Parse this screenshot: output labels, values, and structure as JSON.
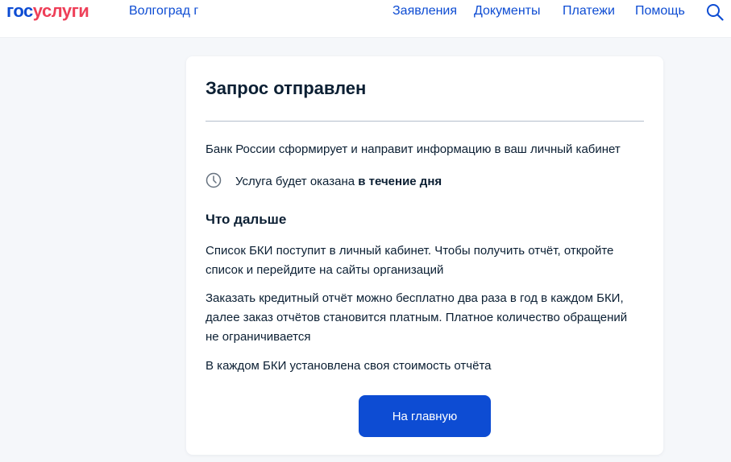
{
  "header": {
    "logo_part1": "гос",
    "logo_part2": "услуги",
    "region": "Волгоград г",
    "nav": [
      "Заявления",
      "Документы",
      "Платежи",
      "Помощь"
    ],
    "search_icon": "search-icon"
  },
  "card": {
    "title": "Запрос отправлен",
    "info": "Банк России сформирует и направит информацию в ваш личный кабинет",
    "service_prefix": "Услуга будет оказана ",
    "service_bold": "в течение дня",
    "clock_icon": "clock-icon",
    "next_title": "Что дальше",
    "paragraphs": [
      "Список БКИ поступит в личный кабинет. Чтобы получить отчёт, откройте список и перейдите на сайты организаций",
      "Заказать кредитный отчёт можно бесплатно два раза в год в каждом БКИ, далее заказ отчётов становится платным. Платное количество обращений не ограничивается",
      "В каждом БКИ установлена своя стоимость отчёта"
    ],
    "button_label": "На главную"
  },
  "colors": {
    "accent": "#0d4cd3",
    "brand_red": "#ee3f58",
    "text": "#0b1f33",
    "background": "#f5f7fa"
  }
}
